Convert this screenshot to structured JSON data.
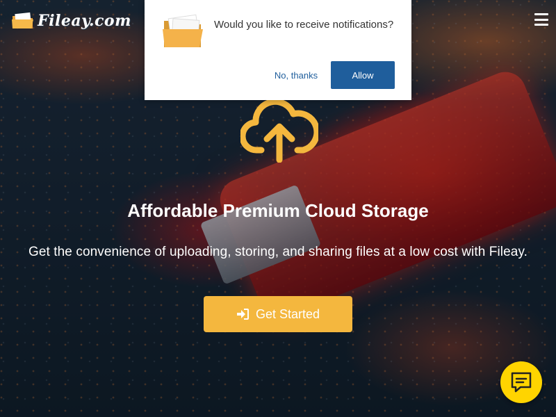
{
  "brand": {
    "name": "Fileay.com"
  },
  "hero": {
    "icon": "cloud-upload-icon",
    "headline": "Affordable Premium Cloud Storage",
    "subline": "Get the convenience of uploading, storing, and sharing files at a low cost with Fileay.",
    "cta_label": "Get Started",
    "cta_icon": "sign-in-icon"
  },
  "notification_prompt": {
    "icon": "folder-icon",
    "message": "Would you like to receive notifications?",
    "decline_label": "No, thanks",
    "accept_label": "Allow"
  },
  "nav": {
    "menu_icon": "hamburger-menu-icon"
  },
  "chat": {
    "icon": "chat-icon"
  },
  "colors": {
    "accent": "#f4b73e",
    "allow_button": "#1f5e9c",
    "chat_button": "#ffd400",
    "text": "#ffffff"
  }
}
